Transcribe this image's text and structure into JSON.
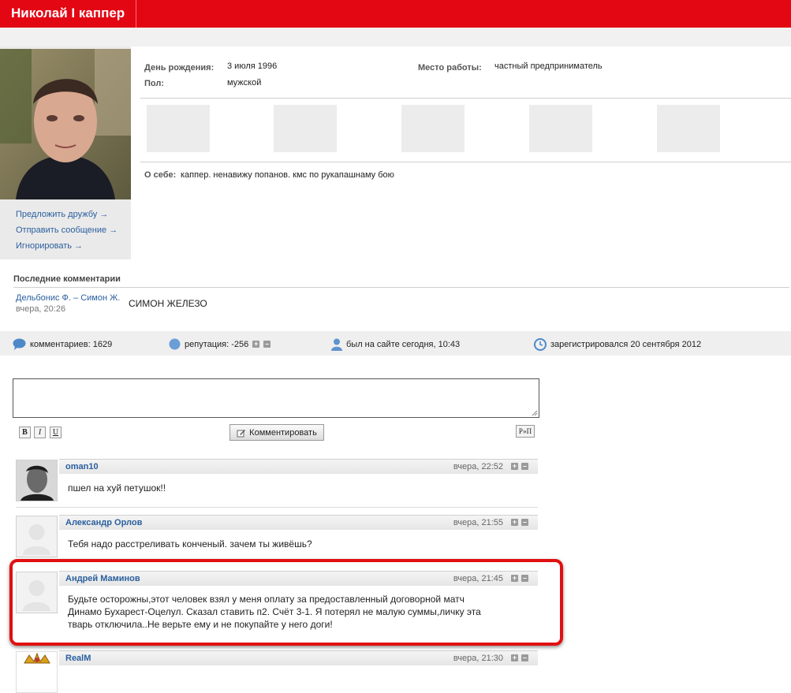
{
  "header": {
    "title": "Николай I каппер"
  },
  "profile": {
    "links": [
      "Предложить дружбу →",
      "Отправить сообщение →",
      "Игнорировать →"
    ],
    "birthday_label": "День рождения:",
    "birthday_value": "3 июля 1996",
    "gender_label": "Пол:",
    "gender_value": "мужской",
    "work_label": "Место работы:",
    "work_value": "частный предприниматель",
    "about_label": "О себе:",
    "about_value": "каппер. ненавижу попанов. кмс по рукапашнаму бою"
  },
  "recent_comments": {
    "heading": "Последние комментарии",
    "link": "Дельбонис Ф. – Симон Ж.",
    "time": "вчера, 20:26",
    "text": "СИМОН ЖЕЛЕЗО"
  },
  "stats": {
    "comments": "комментариев: 1629",
    "reputation": "репутация: -256",
    "last_seen": "был на сайте сегодня, 10:43",
    "registered": "зарегистрировался 20 сентября 2012"
  },
  "editor": {
    "bold": "B",
    "italic": "I",
    "underline": "U",
    "submit_label": "Комментировать",
    "translit": "Р»П"
  },
  "comments": [
    {
      "author": "oman10",
      "time": "вчера, 22:52",
      "text": "пшел на хуй петушок!!"
    },
    {
      "author": "Александр Орлов",
      "time": "вчера, 21:55",
      "text": "Тебя надо расстреливать конченый. зачем ты живёшь?"
    },
    {
      "author": "Андрей Маминов",
      "time": "вчера, 21:45",
      "text_lines": [
        "Будьте осторожны,этот человек взял у меня оплату за предоставленный договорной матч",
        "Динамо Бухарест-Оцелул. Сказал ставить п2. Счёт 3-1. Я потерял не малую суммы,личку эта",
        "тварь отключила..Не верьте ему и не покупайте у него доги!"
      ]
    },
    {
      "author": "RealM",
      "time": "вчера, 21:30"
    }
  ],
  "colors": {
    "brand_red": "#e30613",
    "link_blue": "#2a5f9e",
    "highlight_red": "#e01010"
  }
}
